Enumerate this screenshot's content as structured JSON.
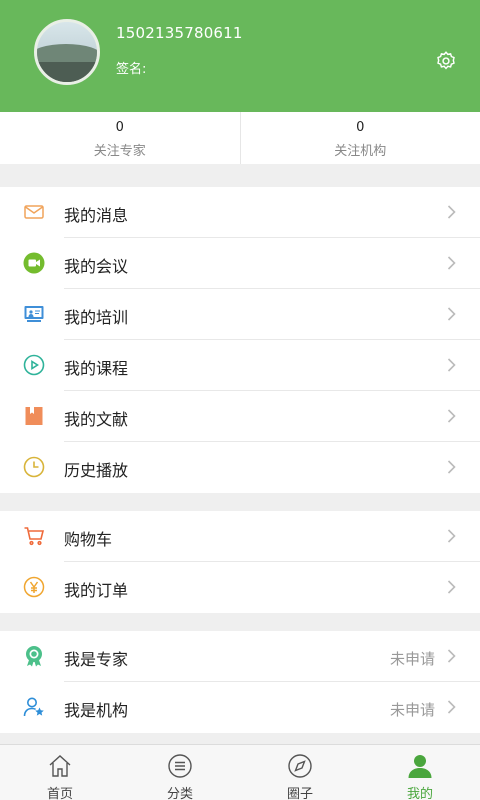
{
  "profile": {
    "phone": "1502135780611",
    "signature_label": "签名:"
  },
  "stats": [
    {
      "count": "0",
      "label": "关注专家"
    },
    {
      "count": "0",
      "label": "关注机构"
    }
  ],
  "menu_group_1": [
    {
      "label": "我的消息",
      "icon": "envelope-icon"
    },
    {
      "label": "我的会议",
      "icon": "video-camera-icon"
    },
    {
      "label": "我的培训",
      "icon": "presentation-board-icon"
    },
    {
      "label": "我的课程",
      "icon": "play-circle-icon"
    },
    {
      "label": "我的文献",
      "icon": "bookmark-book-icon"
    },
    {
      "label": "历史播放",
      "icon": "clock-icon"
    }
  ],
  "menu_group_2": [
    {
      "label": "购物车",
      "icon": "shopping-cart-icon"
    },
    {
      "label": "我的订单",
      "icon": "yen-circle-icon"
    }
  ],
  "menu_group_3": [
    {
      "label": "我是专家",
      "value": "未申请",
      "icon": "expert-badge-icon"
    },
    {
      "label": "我是机构",
      "value": "未申请",
      "icon": "user-star-icon"
    }
  ],
  "tabbar": [
    {
      "label": "首页",
      "icon": "home-icon"
    },
    {
      "label": "分类",
      "icon": "list-circle-icon"
    },
    {
      "label": "圈子",
      "icon": "compass-icon"
    },
    {
      "label": "我的",
      "icon": "person-icon"
    }
  ],
  "colors": {
    "header_green": "#68b85b",
    "active_tab": "#4aa63d",
    "page_bg": "#efefef"
  }
}
